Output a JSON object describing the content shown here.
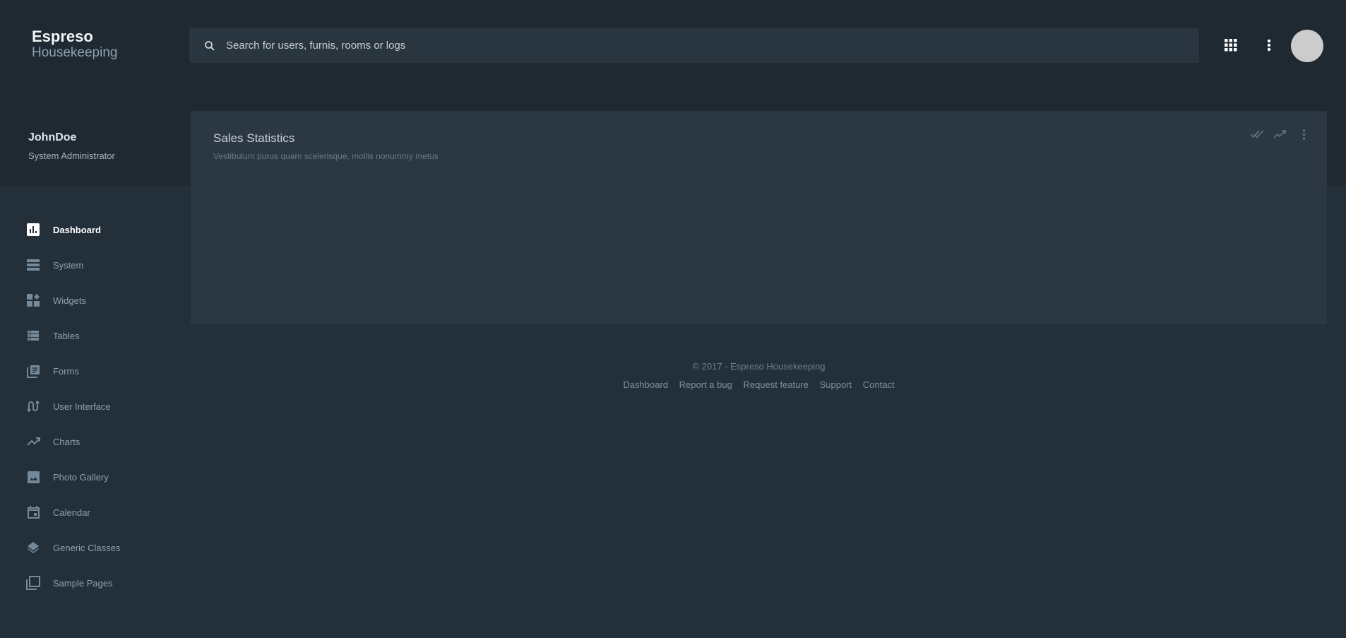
{
  "brand": {
    "name": "Espreso",
    "subtitle": "Housekeeping"
  },
  "search": {
    "placeholder": "Search for users, furnis, rooms or logs",
    "value": ""
  },
  "header_icons": [
    "apps-grid-icon",
    "more-vert-icon",
    "avatar"
  ],
  "user": {
    "name": "JohnDoe",
    "role": "System Administrator"
  },
  "sidebar": {
    "items": [
      {
        "label": "Dashboard",
        "icon": "dashboard-icon",
        "active": true
      },
      {
        "label": "System",
        "icon": "system-icon"
      },
      {
        "label": "Widgets",
        "icon": "widgets-icon"
      },
      {
        "label": "Tables",
        "icon": "tables-icon"
      },
      {
        "label": "Forms",
        "icon": "forms-icon"
      },
      {
        "label": "User Interface",
        "icon": "user-interface-icon"
      },
      {
        "label": "Charts",
        "icon": "charts-icon"
      },
      {
        "label": "Photo Gallery",
        "icon": "photo-icon"
      },
      {
        "label": "Calendar",
        "icon": "calendar-icon"
      },
      {
        "label": "Generic Classes",
        "icon": "layers-icon"
      },
      {
        "label": "Sample Pages",
        "icon": "pages-icon"
      }
    ]
  },
  "card": {
    "title": "Sales Statistics",
    "subtitle": "Vestibulum purus quam scelerisque, mollis nonummy metus",
    "actions": [
      "done-all-icon",
      "trending-up-icon",
      "more-vert-icon"
    ]
  },
  "footer": {
    "copyright": "© 2017 - Espreso Housekeeping",
    "links": [
      "Dashboard",
      "Report a bug",
      "Request feature",
      "Support",
      "Contact"
    ]
  },
  "colors": {
    "header_bg": "#1e2932",
    "body_bg": "#232f39",
    "card_bg": "#2b3843",
    "avatar": "#cccccc"
  }
}
